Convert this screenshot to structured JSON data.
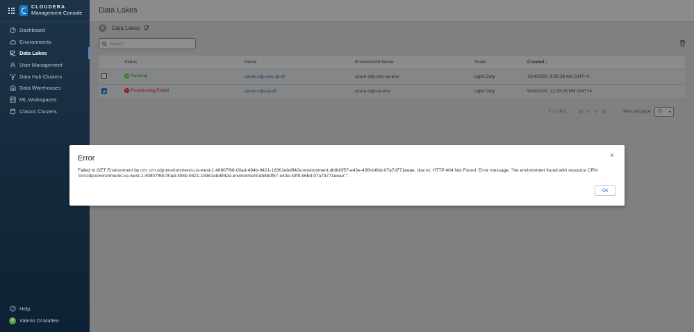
{
  "sidebar": {
    "brand_name": "CLOUDERA",
    "brand_sub": "Management Console",
    "items": [
      {
        "label": "Dashboard",
        "icon": "dashboard-icon"
      },
      {
        "label": "Environments",
        "icon": "cloud-icon"
      },
      {
        "label": "Data Lakes",
        "icon": "data-lake-icon",
        "active": true
      },
      {
        "label": "User Management",
        "icon": "users-icon"
      },
      {
        "label": "Data Hub Clusters",
        "icon": "datahub-icon"
      },
      {
        "label": "Data Warehouses",
        "icon": "warehouse-icon"
      },
      {
        "label": "ML Workspaces",
        "icon": "ml-icon"
      },
      {
        "label": "Classic Clusters",
        "icon": "classic-cluster-icon"
      }
    ],
    "help_label": "Help",
    "user_initial": "V",
    "user_name": "Valerio Di Matteo"
  },
  "header": {
    "title": "Data Lakes"
  },
  "list": {
    "count": "2",
    "title": "Data Lakes",
    "search_placeholder": "Search"
  },
  "table": {
    "columns": [
      "Status",
      "Name",
      "Environment Name",
      "Scale",
      "Created"
    ],
    "rows": [
      {
        "checked": false,
        "status": "Running",
        "status_type": "ok",
        "name": "azure-cdp-poc-cp-dl",
        "env": "azure-cdp-poc-cp-env",
        "scale": "Light Duty",
        "created": "10/4/2020, 8:39:38 AM GMT+4"
      },
      {
        "checked": true,
        "status": "Provisioning Failed",
        "status_type": "fail",
        "name": "azure-cdp-cp-dl",
        "env": "azure-cdp-cp-env",
        "scale": "Light Duty",
        "created": "9/24/2020, 12:33:28 PM GMT+4"
      }
    ]
  },
  "pagination": {
    "range": "1 – 2 of 2",
    "items_per_page_label": "Items per page:",
    "items_per_page": "25"
  },
  "modal": {
    "title": "Error",
    "close": "×",
    "message": "Failed to GET Environment by crn: crn:cdp:environments:us-west-1:40807f68-00ad-494b-9421-18361ebd942e:environment:db8b0f57-e43e-43f9-b6bd-07a7d771eeae, due to: HTTP 404 Not Found. Error message: \"No environment found with resource CRN 'crn:cdp:environments:us-west-1:40807f68-00ad-494b-9421-18361ebd942e:environment:db8b0f57-e43e-43f9-b6bd-07a7d771eeae'.\".",
    "ok_label": "Ok"
  },
  "colors": {
    "sidebar_bg": "#1d3448",
    "accent": "#3d8fd8",
    "running": "#4caf50",
    "failed": "#d32f2f",
    "link": "#1a5fa8"
  }
}
